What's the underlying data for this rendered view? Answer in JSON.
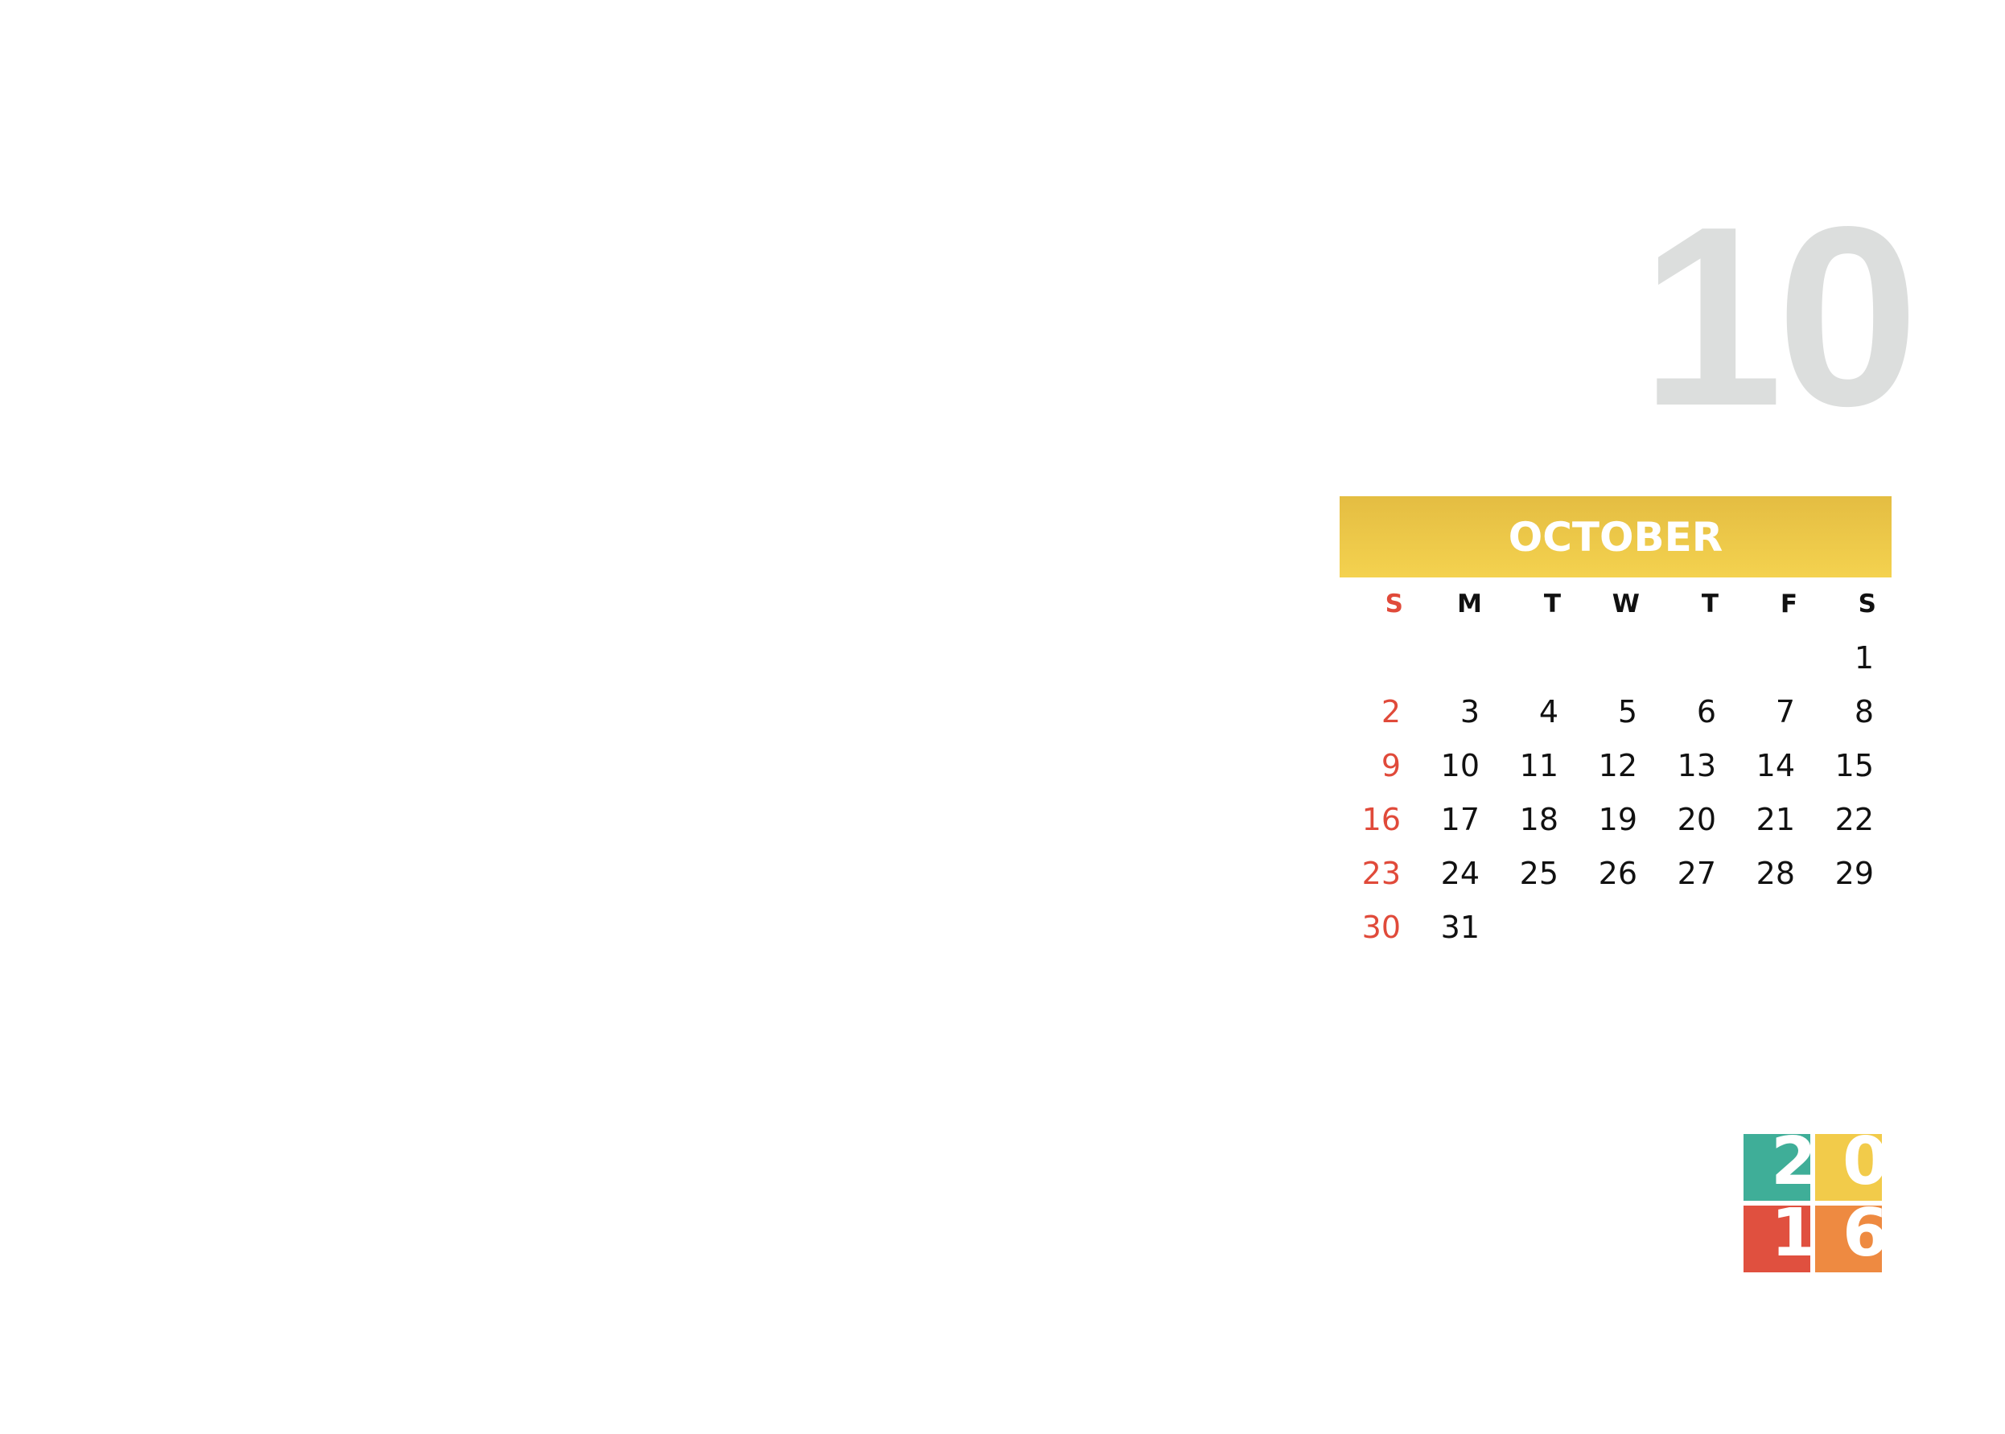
{
  "month_number": "10",
  "month_name": "OCTOBER",
  "weekdays": [
    "S",
    "M",
    "T",
    "W",
    "T",
    "F",
    "S"
  ],
  "weeks": [
    [
      "",
      "",
      "",
      "",
      "",
      "",
      "1"
    ],
    [
      "2",
      "3",
      "4",
      "5",
      "6",
      "7",
      "8"
    ],
    [
      "9",
      "10",
      "11",
      "12",
      "13",
      "14",
      "15"
    ],
    [
      "16",
      "17",
      "18",
      "19",
      "20",
      "21",
      "22"
    ],
    [
      "23",
      "24",
      "25",
      "26",
      "27",
      "28",
      "29"
    ],
    [
      "30",
      "31",
      "",
      "",
      "",
      "",
      ""
    ]
  ],
  "year_digits": [
    "2",
    "0",
    "1",
    "6"
  ],
  "colors": {
    "header_gradient_top": "#e4bd42",
    "header_gradient_bottom": "#f4d24f",
    "sunday": "#e04a3a",
    "big_number": "#dcdedd",
    "year_tile_teal": "#3fae98",
    "year_tile_yellow": "#f2cb4a",
    "year_tile_red": "#e0503f",
    "year_tile_orange": "#ee8a41"
  }
}
